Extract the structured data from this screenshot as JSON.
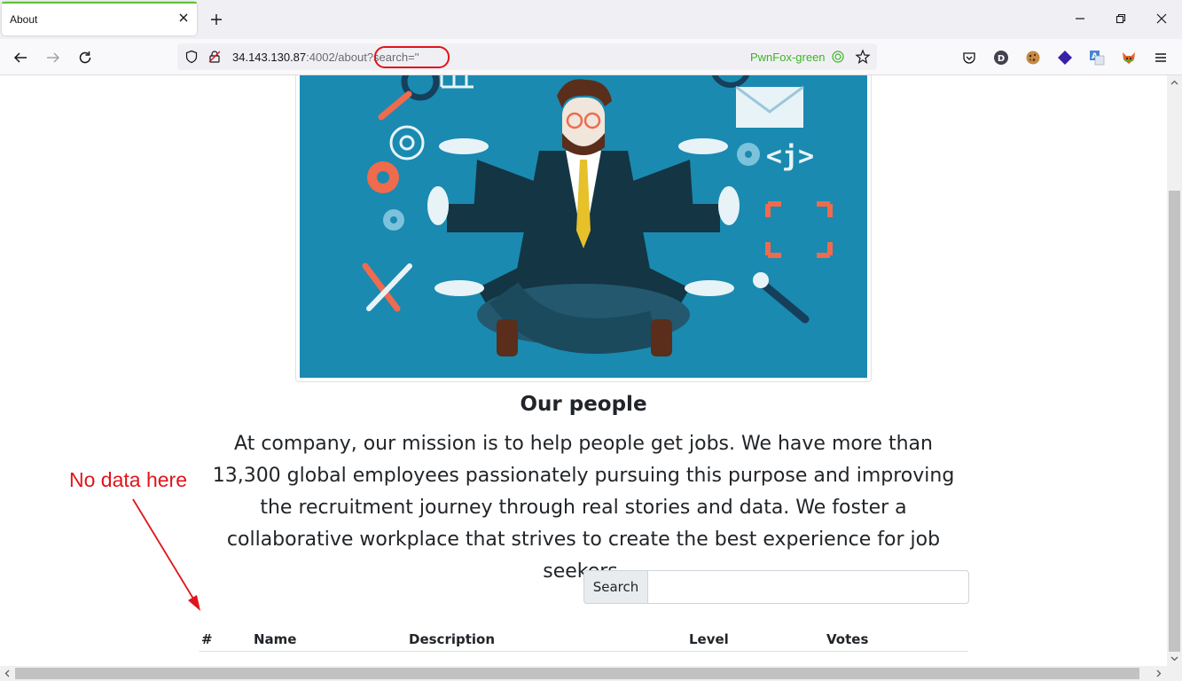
{
  "browser": {
    "tab_title": "About",
    "url_host": "34.143.130.87",
    "url_rest": ":4002/about?search=''",
    "container_label": "PwnFox-green",
    "accent_color": "#60c135",
    "highlight_color": "#e0141b"
  },
  "icons": {
    "tab_close": "close-icon",
    "new_tab": "plus-icon",
    "back": "back-arrow-icon",
    "forward": "forward-arrow-icon",
    "reload": "reload-icon",
    "shield": "shield-icon",
    "lock": "lock-icon",
    "bookmark": "star-icon",
    "pocket": "pocket-icon",
    "menu": "hamburger-icon"
  },
  "page": {
    "heading": "Our people",
    "mission": "At company, our mission is to help people get jobs. We have more than 13,300 global employees passionately pursuing this purpose and improving the recruitment journey through real stories and data. We foster a collaborative workplace that strives to create the best experience for job seekers.",
    "search_label": "Search",
    "search_value": "",
    "table_headers": [
      "#",
      "Name",
      "Description",
      "Level",
      "Votes"
    ],
    "table_rows": []
  },
  "annotation": {
    "text": "No data here"
  }
}
